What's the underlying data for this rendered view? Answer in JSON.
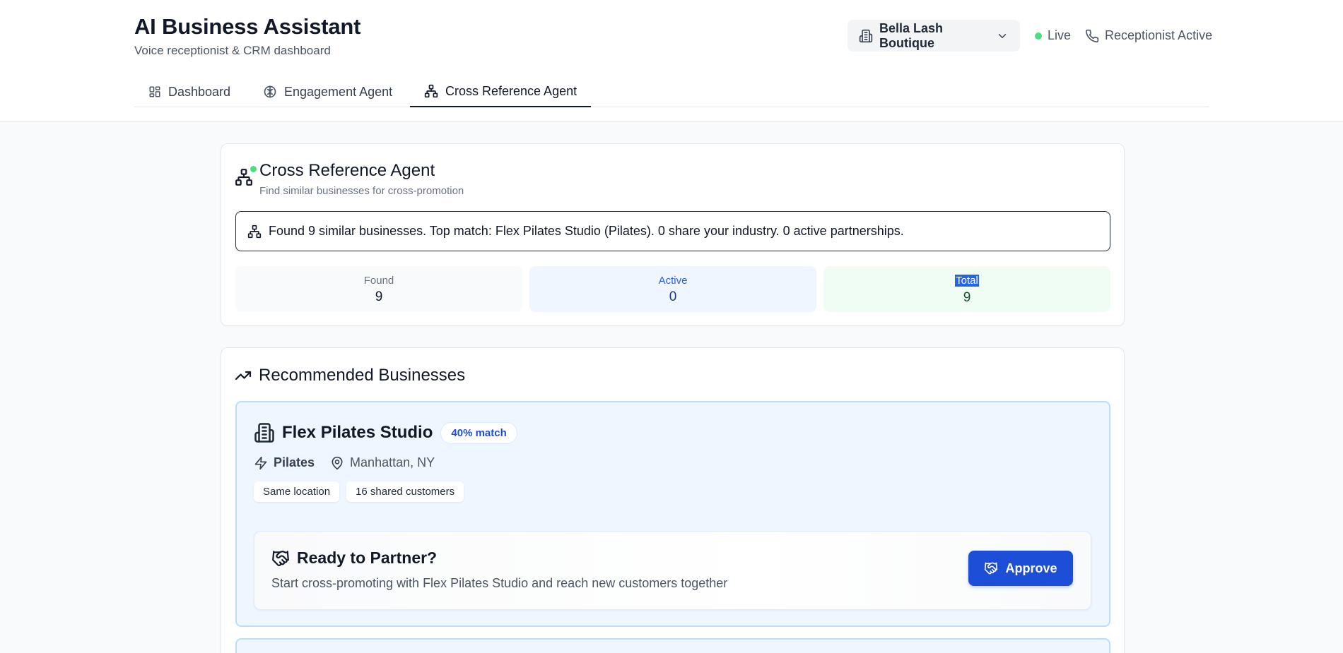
{
  "header": {
    "title": "AI Business Assistant",
    "subtitle": "Voice receptionist & CRM dashboard",
    "business_selector": {
      "label": "Bella Lash Boutique",
      "icon": "building-icon"
    },
    "status_live": "Live",
    "status_receptionist": "Receptionist Active"
  },
  "tabs": [
    {
      "label": "Dashboard",
      "icon": "grid-icon",
      "active": false
    },
    {
      "label": "Engagement Agent",
      "icon": "brain-icon",
      "active": false
    },
    {
      "label": "Cross Reference Agent",
      "icon": "network-icon",
      "active": true
    }
  ],
  "agent": {
    "title": "Cross Reference Agent",
    "subtitle": "Find similar businesses for cross-promotion",
    "summary": "Found 9 similar businesses. Top match: Flex Pilates Studio (Pilates). 0 share your industry. 0 active partnerships.",
    "stats": [
      {
        "label": "Found",
        "value": "9"
      },
      {
        "label": "Active",
        "value": "0"
      },
      {
        "label": "Total",
        "value": "9"
      }
    ]
  },
  "recommended": {
    "title": "Recommended Businesses",
    "businesses": [
      {
        "name": "Flex Pilates Studio",
        "match": "40% match",
        "industry": "Pilates",
        "location": "Manhattan, NY",
        "tags": [
          "Same location",
          "16 shared customers"
        ],
        "partner": {
          "title": "Ready to Partner?",
          "description": "Start cross-promoting with Flex Pilates Studio and reach new customers together",
          "button": "Approve"
        }
      }
    ]
  },
  "colors": {
    "primary": "#1d4ed8",
    "live_dot": "#4ade80",
    "card_highlight": "#eff6ff",
    "active_stat_bg": "#eff6ff",
    "total_stat_bg": "#f0fdf4"
  }
}
